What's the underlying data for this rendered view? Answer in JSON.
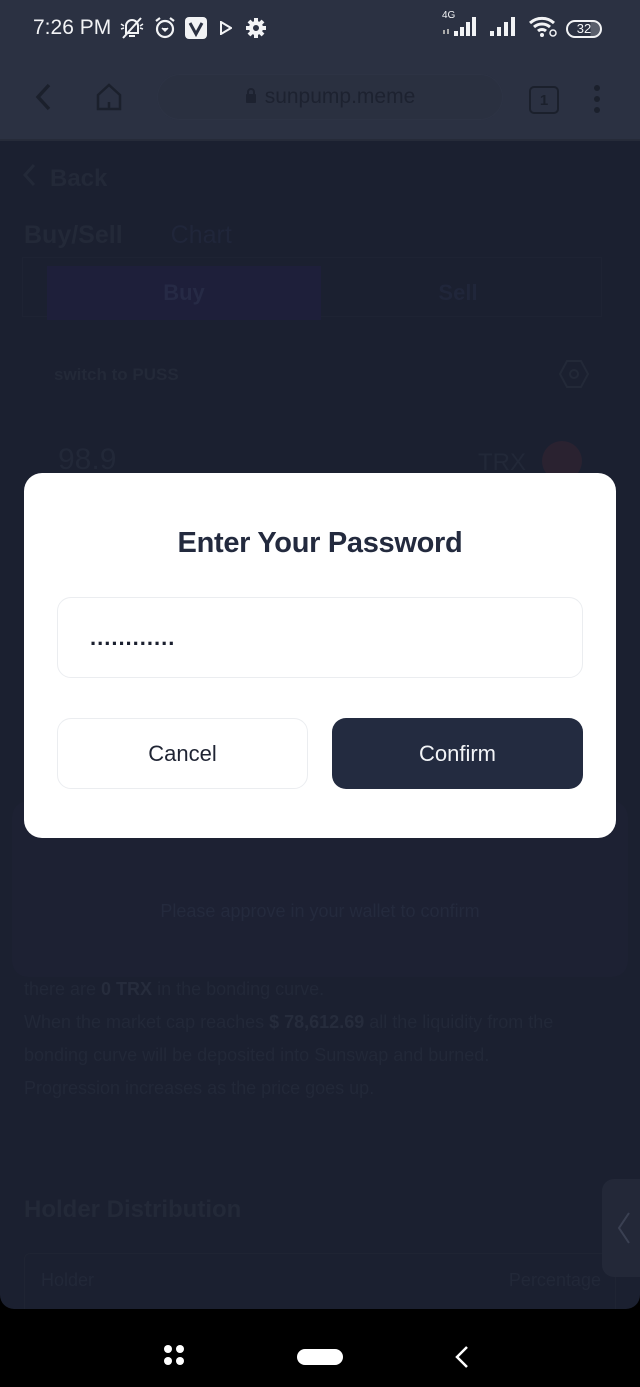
{
  "status_bar": {
    "time": "7:26 PM",
    "left_icons": [
      "notifications-muted-icon",
      "alarm-icon",
      "v-app-icon",
      "play-icon",
      "settings-gear-icon"
    ],
    "network_label": "4G",
    "right_icons": [
      "signal-sim1-icon",
      "signal-sim2-icon",
      "wifi-icon"
    ],
    "battery": "32"
  },
  "browser": {
    "url": "sunpump.meme",
    "tab_count": "1"
  },
  "page": {
    "back_label": "Back",
    "tabs": [
      {
        "label": "Buy/Sell",
        "active": true
      },
      {
        "label": "Chart",
        "active": false
      }
    ],
    "segments": {
      "buy_label": "Buy",
      "sell_label": "Sell"
    },
    "switch_label": "switch to PUSS",
    "amount_value": "98.9",
    "currency": "TRX",
    "wallet_message": "Please approve in your wallet to confirm",
    "info": {
      "line1_prefix": "there are ",
      "line1_bold": "0 TRX",
      "line1_suffix": " in the bonding curve.",
      "line2_prefix": "When the market cap reaches ",
      "line2_bold": "$ 78,612.69",
      "line2_suffix": " all the liquidity from the bonding curve will be deposited into Sunswap and burned.",
      "line3": "Progression increases as the price goes up."
    },
    "holder_distribution": {
      "title": "Holder Distribution",
      "columns": [
        "Holder",
        "Percentage"
      ]
    }
  },
  "modal": {
    "title": "Enter Your Password",
    "password_value": "............",
    "cancel_label": "Cancel",
    "confirm_label": "Confirm"
  },
  "colors": {
    "modal_bg": "#ffffff",
    "confirm_bg": "#232b40",
    "page_bg_dimmed": "#1b2030",
    "title_text": "#232a3e"
  }
}
